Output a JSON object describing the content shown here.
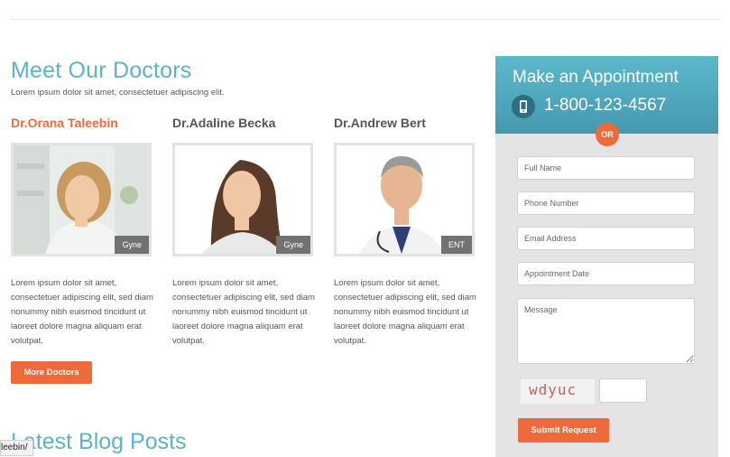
{
  "section": {
    "title": "Meet Our Doctors",
    "subtitle": "Lorem ipsum dolor sit amet, consectetuer adipiscing elit."
  },
  "doctors": [
    {
      "name": "Dr.Orana Taleebin",
      "specialty": "Gyne",
      "description": "Lorem ipsum dolor sit amet, consectetuer adipiscing elit, sed diam nonummy nibh euismod tincidunt ut laoreet dolore magna aliquam erat volutpat."
    },
    {
      "name": "Dr.Adaline Becka",
      "specialty": "Gyne",
      "description": "Lorem ipsum dolor sit amet, consectetuer adipiscing elit, sed diam nonummy nibh euismod tincidunt ut laoreet dolore magna aliquam erat volutpat."
    },
    {
      "name": "Dr.Andrew Bert",
      "specialty": "ENT",
      "description": "Lorem ipsum dolor sit amet, consectetuer adipiscing elit, sed diam nonummy nibh euismod tincidunt ut laoreet dolore magna aliquam erat volutpat."
    }
  ],
  "more_button": "More Doctors",
  "blog_title": "Latest Blog Posts",
  "status_url": "leebin/",
  "appointment": {
    "title": "Make an Appointment",
    "phone": "1-800-123-4567",
    "phone_icon": "mobile-phone-icon",
    "or_label": "OR",
    "fields": {
      "full_name": "Full Name",
      "phone_number": "Phone Number",
      "email": "Email Address",
      "date": "Appointment Date",
      "message": "Message"
    },
    "captcha_text": "wdyuc",
    "submit_label": "Submit Request"
  },
  "colors": {
    "accent_orange": "#ee6a3a",
    "heading_blue": "#5bb3c9",
    "panel_gray": "#e4e4e4",
    "tag_gray": "#727272"
  }
}
